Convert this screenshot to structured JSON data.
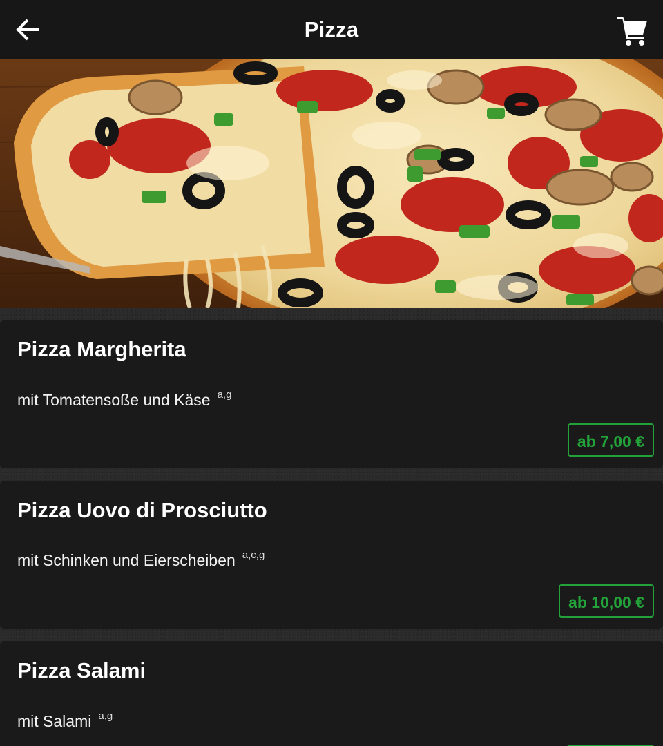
{
  "header": {
    "title": "Pizza",
    "back_icon": "arrow-left-icon",
    "cart_icon": "shopping-cart-icon"
  },
  "hero": {
    "image": "pizza-photo"
  },
  "colors": {
    "header_bg": "#171717",
    "card_bg": "#1a1a1a",
    "accent": "#23a23a",
    "text": "#ffffff"
  },
  "items": [
    {
      "name": "Pizza Margherita",
      "description": "mit Tomatensoße und Käse",
      "allergens": "a,g",
      "price": "ab 7,00 €"
    },
    {
      "name": "Pizza Uovo di Prosciutto",
      "description": "mit Schinken und Eierscheiben",
      "allergens": "a,c,g",
      "price": "ab 10,00 €"
    },
    {
      "name": "Pizza Salami",
      "description": "mit Salami",
      "allergens": "a,g",
      "price": ""
    }
  ]
}
